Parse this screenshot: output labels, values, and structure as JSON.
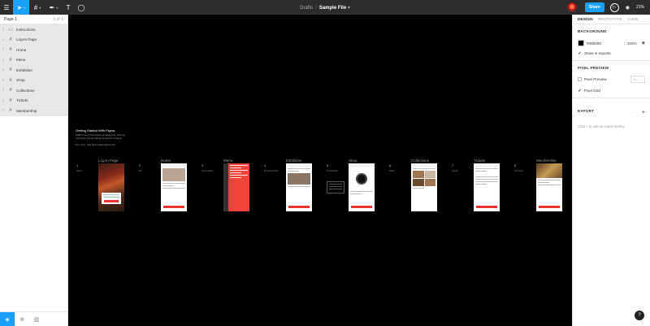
{
  "toolbar": {
    "menu_icon": "☰",
    "move_tool_icon": "➤",
    "frame_tool_icon": "#",
    "pen_tool_icon": "✒",
    "text_tool_icon": "T",
    "comment_tool_icon": "◯",
    "caret": "▾",
    "breadcrumb_parent": "Drafts",
    "breadcrumb_sep": "/",
    "file_name": "Sample File",
    "file_caret": "▾",
    "share_label": "Share",
    "play_icon": "▷",
    "view_icon": "◉",
    "zoom_level": "21%"
  },
  "left_panel": {
    "page_name": "Page 1",
    "page_count": "1 of 1",
    "layers": [
      {
        "name": "Instructions",
        "icon": "▭"
      },
      {
        "name": "Log-In Page",
        "icon": "#"
      },
      {
        "name": "Home",
        "icon": "#"
      },
      {
        "name": "Menu",
        "icon": "#"
      },
      {
        "name": "Exhibition",
        "icon": "#"
      },
      {
        "name": "Shop",
        "icon": "#"
      },
      {
        "name": "Collections",
        "icon": "#"
      },
      {
        "name": "Tickets",
        "icon": "#"
      },
      {
        "name": "Membership",
        "icon": "#"
      }
    ],
    "chevron": "›",
    "bottom_icons": [
      "◈",
      "⊕",
      "▥"
    ]
  },
  "canvas": {
    "intro_heading": "Getting Started With Figma",
    "intro_body": "Walk through the basics of designing, sharing, exporting and providing feedback in Figma.",
    "intro_url": "For more, visit https://help.figma.com",
    "steps": [
      {
        "num": "1",
        "label": "Log-In Page",
        "note": "Select"
      },
      {
        "num": "2",
        "label": "Home",
        "note": "Fill"
      },
      {
        "num": "3",
        "label": "Menu",
        "note": "Use a Shape"
      },
      {
        "num": "4",
        "label": "Exhibition",
        "note": "Prototype Mode"
      },
      {
        "num": "5",
        "label": "Shop",
        "note": "Presentation"
      },
      {
        "num": "6",
        "label": "Collections",
        "note": "Share"
      },
      {
        "num": "7",
        "label": "Tickets",
        "note": "Inspect"
      },
      {
        "num": "8",
        "label": "Membership",
        "note": "Comment"
      }
    ]
  },
  "right_panel": {
    "tabs": [
      "DESIGN",
      "PROTOTYPE",
      "CODE"
    ],
    "background_title": "BACKGROUND",
    "bg_hex": "#000000",
    "bg_opacity": "100%",
    "show_in_exports": "Show in exports",
    "pixel_preview_title": "PIXEL PREVIEW",
    "pixel_preview_label": "Pixel Preview",
    "pixel_preview_unit": "1x",
    "pixel_grid_label": "Pixel Grid",
    "export_title": "EXPORT",
    "export_hint": "Click + to add an export setting",
    "plus_icon": "+",
    "help_icon": "?",
    "check_mark": "✔"
  }
}
